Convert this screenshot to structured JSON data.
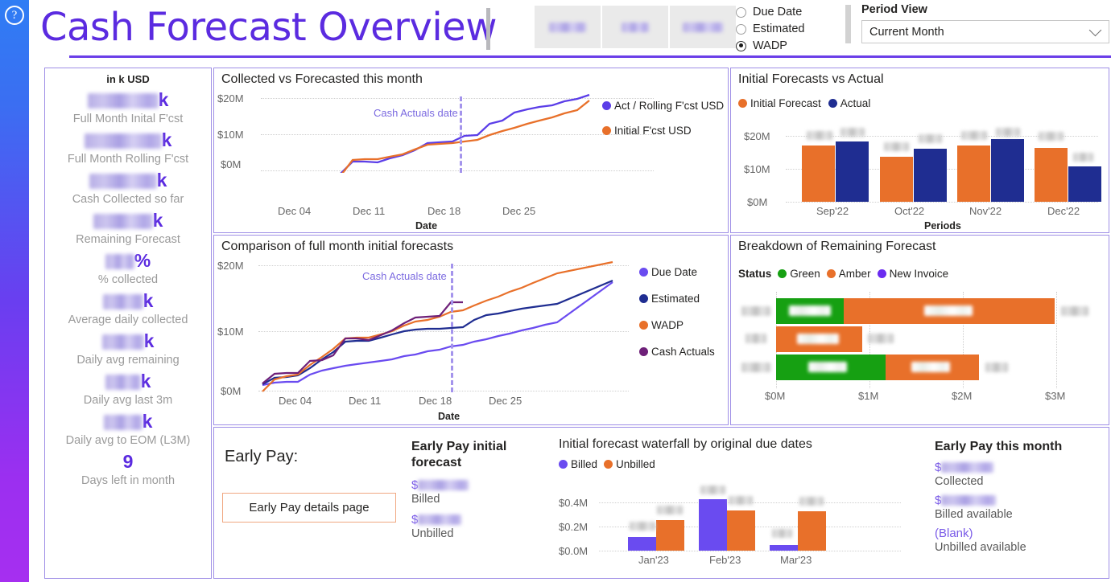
{
  "app": {
    "title": "Cash Forecast Overview",
    "help_icon": "question-circle-icon"
  },
  "header": {
    "slicers": [
      {
        "name": "slicer-tile-1",
        "value_redacted": true
      },
      {
        "name": "slicer-tile-2",
        "value_redacted": true
      },
      {
        "name": "slicer-tile-3",
        "value_redacted": true
      }
    ],
    "radio_group": {
      "options": [
        {
          "label": "Due Date",
          "selected": false
        },
        {
          "label": "Estimated",
          "selected": false
        },
        {
          "label": "WADP",
          "selected": true
        }
      ]
    },
    "period_view": {
      "label": "Period View",
      "value": "Current Month",
      "chevron": "chevron-down-icon"
    }
  },
  "kpi_panel": {
    "unit_label": "in k USD",
    "items": [
      {
        "value": "",
        "redacted": true,
        "suffix": "k",
        "label": "Full Month Inital F'cst"
      },
      {
        "value": "",
        "redacted": true,
        "suffix": "k",
        "label": "Full Month Rolling F'cst"
      },
      {
        "value": "",
        "redacted": true,
        "suffix": "k",
        "label": "Cash Collected so far"
      },
      {
        "value": "",
        "redacted": true,
        "suffix": "k",
        "label": "Remaining Forecast"
      },
      {
        "value": "",
        "redacted": true,
        "suffix": "%",
        "label": "% collected"
      },
      {
        "value": "",
        "redacted": true,
        "suffix": "k",
        "label": "Average daily collected"
      },
      {
        "value": "",
        "redacted": true,
        "suffix": "k",
        "label": "Daily avg remaining"
      },
      {
        "value": "",
        "redacted": true,
        "suffix": "k",
        "label": "Daily avg last 3m"
      },
      {
        "value": "",
        "redacted": true,
        "suffix": "k",
        "label": "Daily avg to EOM (L3M)"
      },
      {
        "value": "9",
        "redacted": false,
        "suffix": "",
        "label": "Days left in month"
      }
    ]
  },
  "colors": {
    "brand_purple": "#5b2be0",
    "line_blue_purple": "#5b3ee8",
    "line_orange": "#e8702a",
    "navy": "#1f2d91",
    "maroon": "#6e2079",
    "green": "#16a012",
    "card_border": "#9f8fe6",
    "rail_top": "#2f7df4",
    "rail_bottom": "#a62ff0"
  },
  "chart_data": [
    {
      "id": "collected-vs-forecasted",
      "type": "line",
      "title": "Collected vs Forecasted this month",
      "xlabel": "Date",
      "ylabel": "",
      "ylim": [
        0,
        20
      ],
      "ytick_labels": [
        "$0M",
        "$10M",
        "$20M"
      ],
      "yticks": [
        0,
        10,
        20
      ],
      "xtick_labels": [
        "Dec 04",
        "Dec 11",
        "Dec 18",
        "Dec 25"
      ],
      "grid": true,
      "legend_position": "right",
      "annotation": {
        "text": "Cash Actuals date",
        "at_x": "Dec 19"
      },
      "series": [
        {
          "name": "Act / Rolling F'cst USD",
          "color": "#5b3ee8",
          "values": [
            1.2,
            2.5,
            2.6,
            2.6,
            3.1,
            3.6,
            4.3,
            6.6,
            6.6,
            6.5,
            7.2,
            7.7,
            8.5,
            9.6,
            9.7,
            9.8,
            10.7,
            10.9,
            12.6,
            13.2,
            14.6,
            15.2,
            15.5,
            15.9,
            16.5,
            17.0,
            17.6
          ]
        },
        {
          "name": "Initial F'cst USD",
          "color": "#e8702a",
          "values": [
            0.2,
            2.2,
            2.5,
            2.5,
            2.9,
            3.4,
            4.1,
            6.9,
            7.0,
            7.0,
            7.4,
            7.9,
            8.7,
            9.5,
            9.6,
            9.8,
            10.0,
            10.3,
            11.1,
            11.7,
            12.3,
            12.9,
            13.4,
            14.0,
            14.6,
            15.2,
            16.8
          ]
        }
      ]
    },
    {
      "id": "initial-forecasts-vs-actual",
      "type": "bar",
      "title": "Initial Forecasts vs Actual",
      "xlabel": "Periods",
      "ylabel": "",
      "ylim": [
        0,
        20
      ],
      "ytick_labels": [
        "$0M",
        "$10M",
        "$20M"
      ],
      "categories": [
        "Sep'22",
        "Oct'22",
        "Nov'22",
        "Dec'22"
      ],
      "grid": true,
      "legend_position": "top-left",
      "data_labels_redacted": true,
      "series": [
        {
          "name": "Initial Forecast",
          "color": "#e8702a",
          "values": [
            17.0,
            13.5,
            17.0,
            16.2
          ]
        },
        {
          "name": "Actual",
          "color": "#1f2d91",
          "values": [
            18.2,
            16.0,
            18.8,
            10.7
          ]
        }
      ]
    },
    {
      "id": "comparison-full-month-initial-forecasts",
      "type": "line",
      "title": "Comparison of full month initial forecasts",
      "xlabel": "Date",
      "ylabel": "",
      "ylim": [
        0,
        20
      ],
      "ytick_labels": [
        "$0M",
        "$10M",
        "$20M"
      ],
      "xtick_labels": [
        "Dec 04",
        "Dec 11",
        "Dec 18",
        "Dec 25"
      ],
      "grid": true,
      "legend_position": "right",
      "annotation": {
        "text": "Cash Actuals date",
        "at_x": "Dec 19"
      },
      "series": [
        {
          "name": "Due Date",
          "color": "#6a4bf0",
          "values": [
            1.0,
            1.3,
            1.4,
            1.4,
            2.4,
            2.9,
            3.2,
            3.6,
            3.8,
            4.0,
            4.3,
            4.5,
            4.9,
            5.2,
            5.6,
            5.9,
            6.3,
            6.6,
            7.0,
            7.4,
            7.8,
            8.2,
            8.6,
            9.0,
            9.4,
            9.8,
            15.8
          ]
        },
        {
          "name": "Estimated",
          "color": "#1f2d91",
          "values": [
            1.1,
            2.0,
            2.1,
            2.3,
            3.3,
            4.4,
            5.4,
            6.7,
            6.8,
            6.8,
            7.2,
            7.7,
            8.1,
            8.3,
            8.4,
            8.4,
            8.5,
            8.6,
            9.6,
            10.2,
            10.4,
            10.7,
            11.0,
            11.2,
            11.4,
            11.6,
            16.0
          ]
        },
        {
          "name": "WADP",
          "color": "#e8702a",
          "values": [
            0.2,
            1.8,
            2.2,
            2.4,
            3.6,
            4.6,
            5.6,
            6.9,
            7.0,
            7.0,
            7.4,
            7.8,
            8.5,
            9.0,
            9.2,
            9.6,
            10.2,
            10.4,
            11.0,
            11.6,
            12.1,
            12.7,
            13.2,
            13.8,
            14.4,
            15.0,
            17.2
          ]
        },
        {
          "name": "Cash Actuals",
          "color": "#6e2079",
          "values": [
            1.2,
            2.4,
            2.5,
            2.5,
            4.0,
            4.1,
            4.7,
            6.9,
            6.9,
            6.7,
            7.3,
            7.9,
            8.8,
            9.5,
            9.6,
            9.7,
            11.2,
            11.2,
            null,
            null,
            null,
            null,
            null,
            null,
            null,
            null,
            null
          ]
        }
      ]
    },
    {
      "id": "breakdown-of-remaining-forecast",
      "type": "bar",
      "orientation": "horizontal",
      "stacked": true,
      "title": "Breakdown of Remaining Forecast",
      "legend_title": "Status",
      "xlim": [
        0,
        3.3
      ],
      "xtick_labels": [
        "$0M",
        "$1M",
        "$2M",
        "$3M"
      ],
      "xticks": [
        0,
        1,
        2,
        3
      ],
      "categories_redacted": true,
      "categories": [
        "",
        "",
        ""
      ],
      "data_labels_redacted": true,
      "grid": true,
      "series": [
        {
          "name": "Green",
          "color": "#16a012",
          "values": [
            0.72,
            0.0,
            1.17
          ]
        },
        {
          "name": "Amber",
          "color": "#e8702a",
          "values": [
            2.26,
            0.92,
            0.93
          ]
        },
        {
          "name": "New Invoice",
          "color": "#6a2bf0",
          "values": [
            0,
            0,
            0
          ]
        }
      ],
      "total_labels_redacted": true
    },
    {
      "id": "initial-forecast-waterfall",
      "type": "bar",
      "title": "Initial forecast waterfall by original due dates",
      "ylim": [
        0,
        0.48
      ],
      "ytick_labels": [
        "$0.0M",
        "$0.2M",
        "$0.4M"
      ],
      "yticks": [
        0.0,
        0.2,
        0.4
      ],
      "categories": [
        "Jan'23",
        "Feb'23",
        "Mar'23"
      ],
      "grid": true,
      "legend_position": "top-left",
      "data_labels_redacted": true,
      "series": [
        {
          "name": "Billed",
          "color": "#6a4bf0",
          "values": [
            0.115,
            0.425,
            0.045
          ]
        },
        {
          "name": "Unbilled",
          "color": "#e8702a",
          "values": [
            0.255,
            0.335,
            0.325
          ]
        }
      ]
    }
  ],
  "early_pay": {
    "heading": "Early Pay:",
    "details_button": "Early Pay details page",
    "initial_forecast": {
      "heading": "Early Pay initial forecast",
      "rows": [
        {
          "value_prefix": "$",
          "value_redacted": true,
          "label": "Billed"
        },
        {
          "value_prefix": "$",
          "value_redacted": true,
          "label": "Unbilled"
        }
      ]
    },
    "this_month": {
      "heading": "Early Pay this month",
      "rows": [
        {
          "value_prefix": "$",
          "value_redacted": true,
          "value": "",
          "label": "Collected"
        },
        {
          "value_prefix": "$",
          "value_redacted": true,
          "value": "",
          "label": "Billed available"
        },
        {
          "value_prefix": "",
          "value_redacted": false,
          "value": "(Blank)",
          "label": "Unbilled available"
        }
      ]
    }
  }
}
